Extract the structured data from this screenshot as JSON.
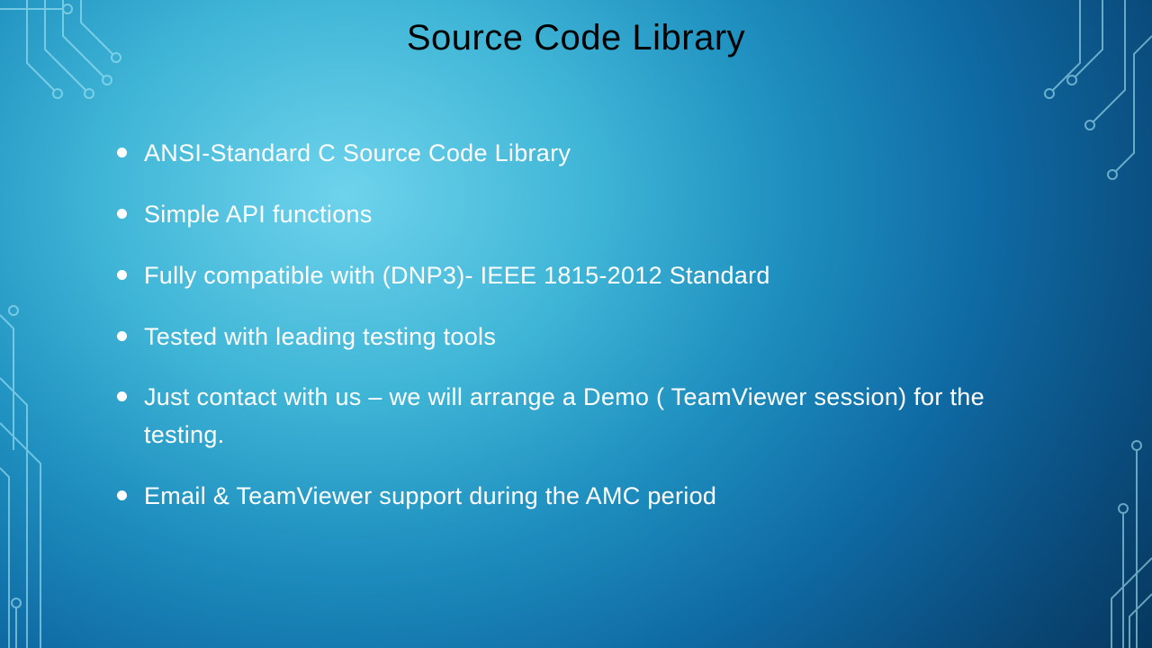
{
  "title": "Source Code Library",
  "bullets": [
    "ANSI-Standard C Source Code Library",
    "Simple API functions",
    "Fully compatible with (DNP3)- IEEE 1815-2012 Standard",
    "Tested with leading testing tools",
    "Just contact with us – we will arrange a Demo ( TeamViewer session) for the testing.",
    "Email & TeamViewer support during the AMC period"
  ]
}
